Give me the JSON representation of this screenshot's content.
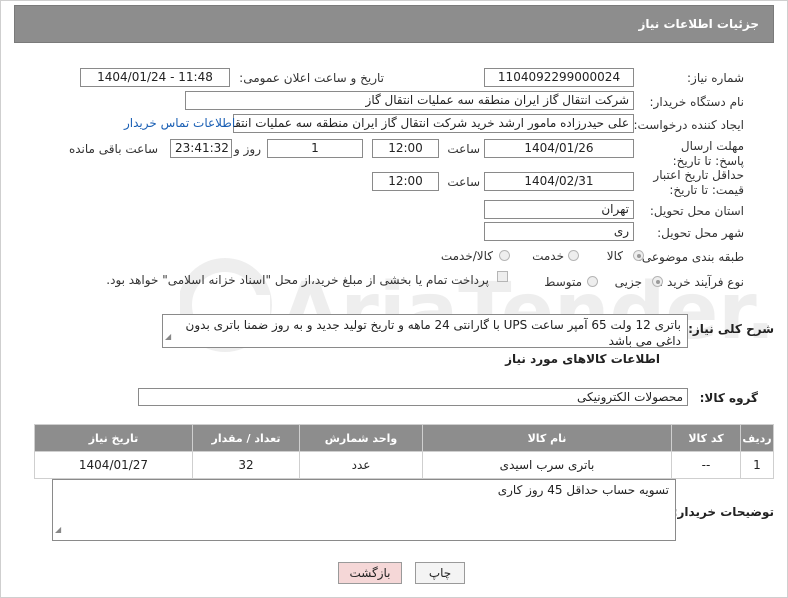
{
  "header": {
    "title": "جزئیات اطلاعات نیاز"
  },
  "labels": {
    "need_number": "شماره نیاز:",
    "announce_datetime": "تاریخ و ساعت اعلان عمومی:",
    "buyer_org": "نام دستگاه خریدار:",
    "requester": "ایجاد کننده درخواست:",
    "reply_deadline": "مهلت ارسال پاسخ: تا تاریخ:",
    "price_validity": "حداقل تاریخ اعتبار قیمت: تا تاریخ:",
    "time": "ساعت",
    "day_and": "روز و",
    "remaining": "ساعت باقی مانده",
    "province": "استان محل تحویل:",
    "city": "شهر محل تحویل:",
    "category": "طبقه بندی موضوعی:",
    "process_type": "نوع فرآیند خرید :",
    "general_desc": "شرح کلی نیاز:",
    "goods_info": "اطلاعات کالاهای مورد نیاز",
    "goods_group": "گروه کالا:",
    "buyer_notes": "توضیحات خریدار:"
  },
  "values": {
    "need_number": "1104092299000024",
    "announce_datetime": "1404/01/24 - 11:48",
    "buyer_org": "شرکت انتقال گاز ایران منطقه سه عملیات انتقال گاز",
    "requester": "علی حیدرزاده مامور ارشد خرید شرکت انتقال گاز ایران منطقه سه عملیات انتقال",
    "contact_link": "اطلاعات تماس خریدار",
    "reply_date": "1404/01/26",
    "reply_time": "12:00",
    "reply_days": "1",
    "reply_remaining": "23:41:32",
    "price_date": "1404/02/31",
    "price_time": "12:00",
    "province": "تهران",
    "city": "ری",
    "category_options": [
      "کالا",
      "خدمت",
      "کالا/خدمت"
    ],
    "process_options": [
      "جزیی",
      "متوسط"
    ],
    "payment_note": "پرداخت تمام یا بخشی از مبلغ خرید،از محل \"اسناد خزانه اسلامی\" خواهد بود.",
    "general_desc": "باتری 12 ولت 65 آمپر ساعت UPS با گارانتی 24 ماهه و تاریخ تولید جدید و به روز ضمنا باتری بدون داغی می باشد",
    "goods_group": "محصولات الکترونیکی",
    "buyer_notes": "تسویه حساب حداقل 45 روز کاری"
  },
  "table": {
    "headers": [
      "ردیف",
      "کد کالا",
      "نام کالا",
      "واحد شمارش",
      "تعداد / مقدار",
      "تاریخ نیاز"
    ],
    "rows": [
      [
        "1",
        "--",
        "باتری سرب اسیدی",
        "عدد",
        "32",
        "1404/01/27"
      ]
    ]
  },
  "buttons": {
    "print": "چاپ",
    "back": "بازگشت"
  },
  "watermark_text": "AriaTender.neT",
  "colors": {
    "header_bg": "#8d8d8d",
    "link": "#1a5fb4",
    "back_button": "#f5d7d7"
  }
}
